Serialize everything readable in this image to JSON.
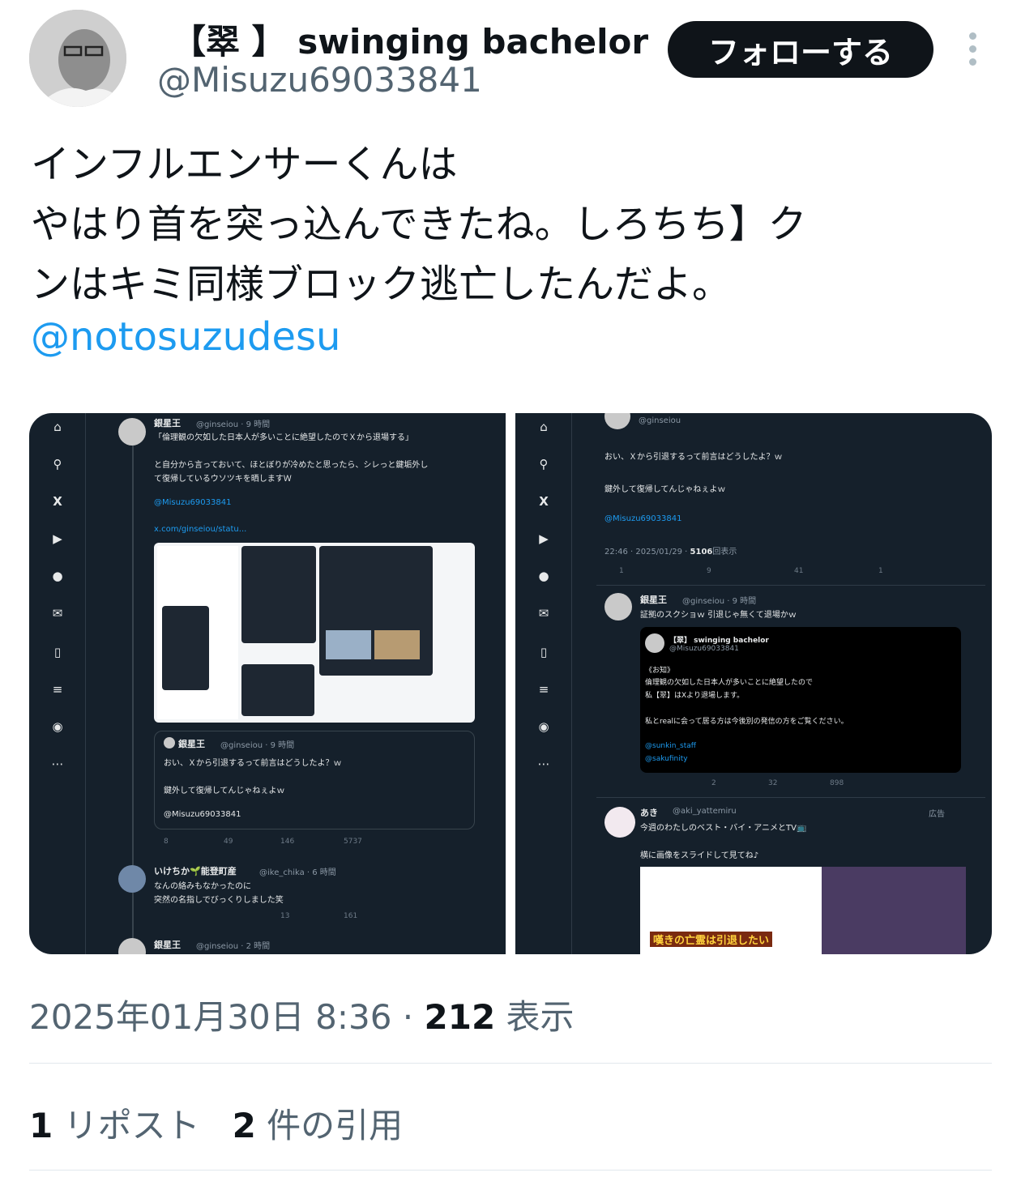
{
  "author": {
    "display_name": "【翠 】 swinging bachelor",
    "handle": "@Misuzu69033841",
    "follow_label": "フォローする"
  },
  "tweet": {
    "lines": [
      "インフルエンサーくんは",
      "やはり首を突っ込んできたね。しろちち】ク",
      "ンはキミ同様ブロック逃亡したんだよ。"
    ],
    "mention": "@notosuzudesu"
  },
  "screenshot_left": {
    "post1": {
      "name": "銀星王",
      "meta": "@ginseiou · 9 時間",
      "text": [
        "「倫理観の欠如した日本人が多いことに絶望したのでＸから退場する」",
        "と自分から言っておいて、ほとぼりが冷めたと思ったら、シレっと鍵垢外し",
        "て復帰しているウソツキを晒しますＷ"
      ],
      "mention": "@Misuzu69033841",
      "link": "x.com/ginseiou/statu..."
    },
    "quote": {
      "name": "銀星王",
      "meta": "@ginseiou · 9 時間",
      "text": [
        "おい、Ｘから引退するって前言はどうしたよ？ｗ",
        "鍵外して復帰してんじゃねぇよｗ",
        "@Misuzu69033841"
      ]
    },
    "post1_actions": [
      "8",
      "49",
      "146",
      "5737"
    ],
    "reply": {
      "name": "いけちか🌱能登町産",
      "meta": "@ike_chika · 6 時間",
      "text": [
        "なんの絡みもなかったのに",
        "突然の名指しでびっくりしました笑"
      ],
      "actions": [
        "13",
        "161"
      ]
    },
    "post3": {
      "name": "銀星王",
      "meta": "@ginseiou · 2 時間"
    }
  },
  "screenshot_right": {
    "top": {
      "meta": "@ginseiou",
      "text": [
        "おい、Ｘから引退するって前言はどうしたよ？ｗ",
        "鍵外して復帰してんじゃねぇよｗ"
      ],
      "mention": "@Misuzu69033841",
      "timestamp": "22:46 · 2025/01/29 · ",
      "views": "5106",
      "views_label": "回表示",
      "actions": [
        "1",
        "9",
        "41",
        "1"
      ]
    },
    "post2": {
      "name": "銀星王",
      "meta": "@ginseiou · 9 時間",
      "text": "証拠のスクショｗ 引退じゃ無くて退場かｗ",
      "card": {
        "name": "【翠】 swinging bachelor",
        "handle": "@Misuzu69033841",
        "lines": [
          "《お知》",
          "倫理観の欠如した日本人が多いことに絶望したので",
          "私【翠】はXより退場します。",
          "私とrealに会って居る方は今後別の発信の方をご覧ください。"
        ],
        "links": [
          "@sunkin_staff",
          "@sakufinity"
        ]
      },
      "actions": [
        "2",
        "32",
        "898"
      ]
    },
    "ad": {
      "name": "あき",
      "meta": "@aki_yattemiru",
      "ad_label": "広告",
      "text": [
        "今週のわたしのベスト・バイ・アニメとTV📺",
        "横に画像をスライドして見てね♪"
      ],
      "banner_text": "嘆きの亡霊は引退したい"
    }
  },
  "footer": {
    "timestamp": "2025年01月30日 8:36 · ",
    "views_count": "212",
    "views_label": " 表示",
    "reposts_count": "1",
    "reposts_label": " リポスト",
    "quotes_count": "2",
    "quotes_label": " 件の引用"
  },
  "icons": {
    "rail": [
      "home-icon",
      "search-icon",
      "grok-icon",
      "play-icon",
      "bell-icon",
      "mail-icon",
      "bookmark-icon",
      "list-icon",
      "profile-icon",
      "more-icon"
    ]
  },
  "colors": {
    "accent": "#1d9bf0",
    "dark_bg": "#15202b",
    "text": "#0f1419",
    "muted": "#536471"
  }
}
